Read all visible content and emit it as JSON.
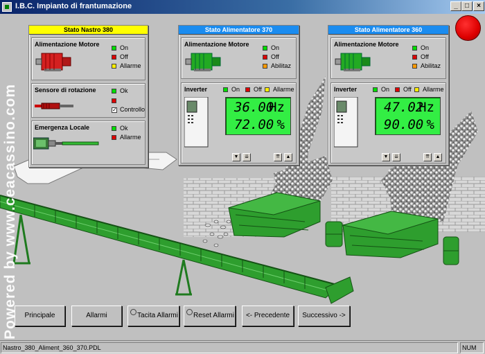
{
  "window": {
    "title": "I.B.C. Impianto di frantumazione",
    "min_label": "_",
    "max_label": "□",
    "close_label": "×"
  },
  "watermark": "Powered by www.ceacassino.com",
  "nastro": {
    "header": "Stato Nastro 380",
    "motore": {
      "title": "Alimentazione Motore",
      "on": "On",
      "off": "Off",
      "allarme": "Allarme"
    },
    "sensore": {
      "title": "Sensore di rotazione",
      "ok": "Ok",
      "controllo": "Controllo",
      "check_mark": "✓"
    },
    "emergenza": {
      "title": "Emergenza Locale",
      "ok": "Ok",
      "allarme": "Allarme"
    }
  },
  "alim370": {
    "header": "Stato Alimentatore 370",
    "motore": {
      "title": "Alimentazione Motore",
      "on": "On",
      "off": "Off",
      "abilitaz": "Abilitaz"
    },
    "inverter": {
      "title": "Inverter",
      "on": "On",
      "off": "Off",
      "allarme": "Allarme",
      "hz_value": "36.00",
      "hz_unit": "Hz",
      "pct_value": "72.00",
      "pct_unit": "%"
    }
  },
  "alim360": {
    "header": "Stato Alimentatore 360",
    "motore": {
      "title": "Alimentazione Motore",
      "on": "On",
      "off": "Off",
      "abilitaz": "Abilitaz"
    },
    "inverter": {
      "title": "Inverter",
      "on": "On",
      "off": "Off",
      "allarme": "Allarme",
      "hz_value": "47.02",
      "hz_unit": "Hz",
      "pct_value": "90.00",
      "pct_unit": "%"
    }
  },
  "buttons": {
    "principale": "Principale",
    "allarmi": "Allarmi",
    "tacita": "Tacita Allarmi",
    "reset": "Reset Allarmi",
    "precedente": "<- Precedente",
    "successivo": "Successivo ->"
  },
  "statusbar": {
    "file": "Nastro_380_Aliment_360_370.PDL",
    "num": "NUM"
  },
  "colors": {
    "led_green": "#00dd00",
    "led_red": "#dd0000",
    "lcd": "#33ee44",
    "machine_green": "#2e9e2e",
    "alarm_lamp": "#ff0000"
  },
  "icons": {
    "down": "▼",
    "down_fast": "⇊",
    "up_fast": "⇈",
    "up": "▲"
  }
}
